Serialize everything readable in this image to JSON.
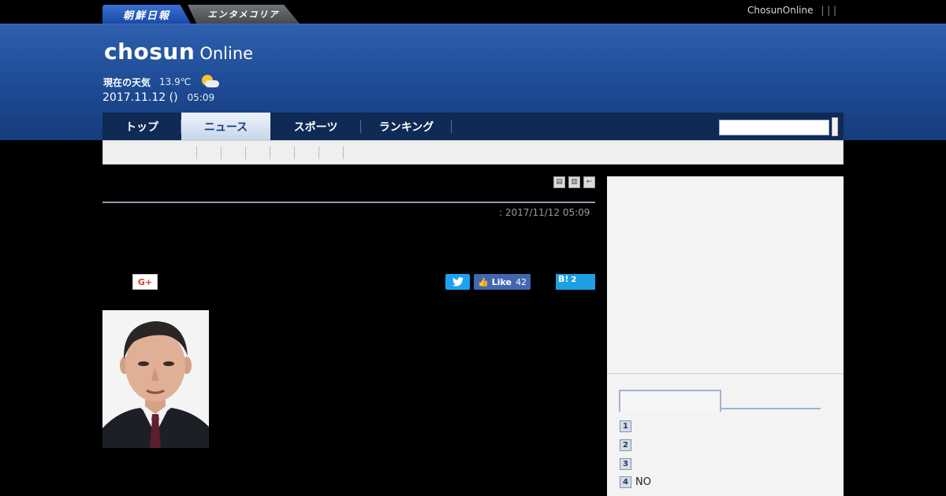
{
  "header": {
    "brand_tabs": [
      "朝鮮日報",
      "エンタメコリア"
    ],
    "top_links": {
      "site": "ChosunOnline",
      "separators": "| | |"
    },
    "logo": {
      "main": "chosun",
      "sub": "Online"
    },
    "weather": {
      "label": "現在の天気",
      "temperature": "13.9℃",
      "icon": "partly-cloudy-icon"
    },
    "date": "2017.11.12 ()",
    "time": "05:09"
  },
  "nav": {
    "items": [
      {
        "label": "トップ",
        "active": false
      },
      {
        "label": "ニュース",
        "active": true
      },
      {
        "label": "スポーツ",
        "active": false
      },
      {
        "label": "ランキング",
        "active": false
      }
    ],
    "search_placeholder": ""
  },
  "article": {
    "published": ": 2017/11/12 05:09",
    "toolbar_icons": [
      "print-icon",
      "text-icon",
      "back-icon"
    ],
    "share": {
      "google_plus": "G+",
      "twitter_icon": "twitter-bird-icon",
      "facebook": {
        "label": "Like",
        "count": "42"
      },
      "hatena": {
        "label": "B!",
        "count": "2"
      }
    },
    "photo_alt": "portrait-photo"
  },
  "sidebar": {
    "ranking": [
      {
        "rank": "1",
        "title": ""
      },
      {
        "rank": "2",
        "title": ""
      },
      {
        "rank": "3",
        "title": ""
      },
      {
        "rank": "4",
        "title": "NO"
      }
    ]
  },
  "colors": {
    "masthead": "#1d4a93",
    "nav_bg": "#0f2a55",
    "active_tab_text": "#1b3f7e",
    "twitter": "#1da1f2",
    "facebook": "#4267b2",
    "hatena": "#1e9ee3"
  }
}
